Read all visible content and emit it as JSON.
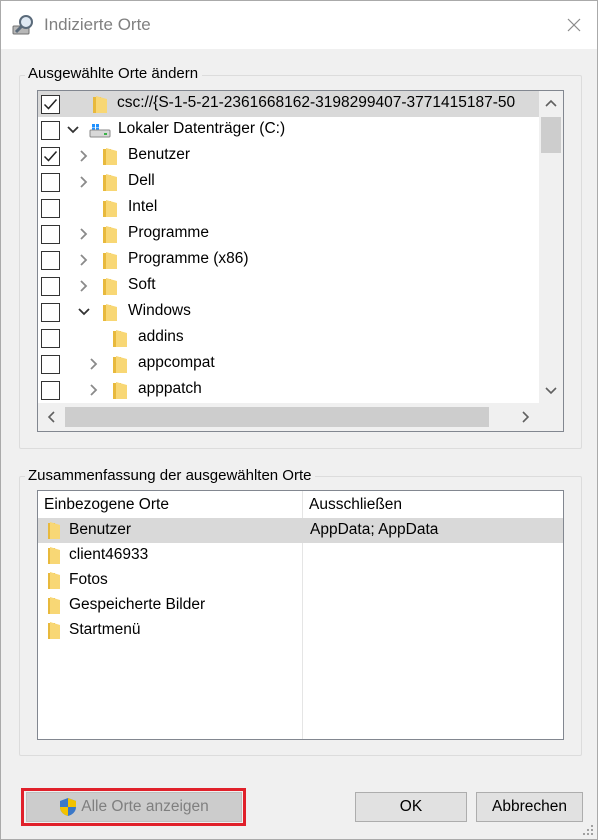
{
  "window": {
    "title": "Indizierte Orte",
    "title_icon": "magnifier-icon",
    "close_icon": "close-icon"
  },
  "locations_group": {
    "label": "Ausgewählte Orte ändern",
    "rows": [
      {
        "label": "csc://{S-1-5-21-2361668162-3198299407-3771415187-50",
        "checked": true,
        "expander": "none",
        "icon": "folder-icon",
        "selected": true
      },
      {
        "label": "Lokaler Datenträger (C:)",
        "checked": false,
        "expander": "expanded",
        "icon": "drive-icon",
        "selected": false
      },
      {
        "label": "Benutzer",
        "checked": true,
        "expander": "collapsed",
        "icon": "folder-icon",
        "selected": false
      },
      {
        "label": "Dell",
        "checked": false,
        "expander": "collapsed",
        "icon": "folder-icon",
        "selected": false
      },
      {
        "label": "Intel",
        "checked": false,
        "expander": "none",
        "icon": "folder-icon",
        "selected": false
      },
      {
        "label": "Programme",
        "checked": false,
        "expander": "collapsed",
        "icon": "folder-icon",
        "selected": false
      },
      {
        "label": "Programme (x86)",
        "checked": false,
        "expander": "collapsed",
        "icon": "folder-icon",
        "selected": false
      },
      {
        "label": "Soft",
        "checked": false,
        "expander": "collapsed",
        "icon": "folder-icon",
        "selected": false
      },
      {
        "label": "Windows",
        "checked": false,
        "expander": "expanded",
        "icon": "folder-icon",
        "selected": false
      },
      {
        "label": "addins",
        "checked": false,
        "expander": "none",
        "icon": "folder-icon",
        "selected": false
      },
      {
        "label": "appcompat",
        "checked": false,
        "expander": "collapsed",
        "icon": "folder-icon",
        "selected": false
      },
      {
        "label": "apppatch",
        "checked": false,
        "expander": "collapsed",
        "icon": "folder-icon",
        "selected": false
      }
    ]
  },
  "summary_group": {
    "label": "Zusammenfassung der ausgewählten Orte",
    "columns": {
      "included": "Einbezogene Orte",
      "excluded": "Ausschließen"
    },
    "rows": [
      {
        "included": "Benutzer",
        "excluded": "AppData; AppData",
        "selected": true
      },
      {
        "included": "client46933",
        "excluded": "",
        "selected": false
      },
      {
        "included": "Fotos",
        "excluded": "",
        "selected": false
      },
      {
        "included": "Gespeicherte Bilder",
        "excluded": "",
        "selected": false
      },
      {
        "included": "Startmenü",
        "excluded": "",
        "selected": false
      }
    ]
  },
  "buttons": {
    "show_all": "Alle Orte anzeigen",
    "show_all_icon": "uac-shield-icon",
    "ok": "OK",
    "cancel": "Abbrechen"
  },
  "colors": {
    "highlight_border": "#e0202a",
    "selected_row": "#d9d9d9",
    "folder": "#f8d775"
  }
}
